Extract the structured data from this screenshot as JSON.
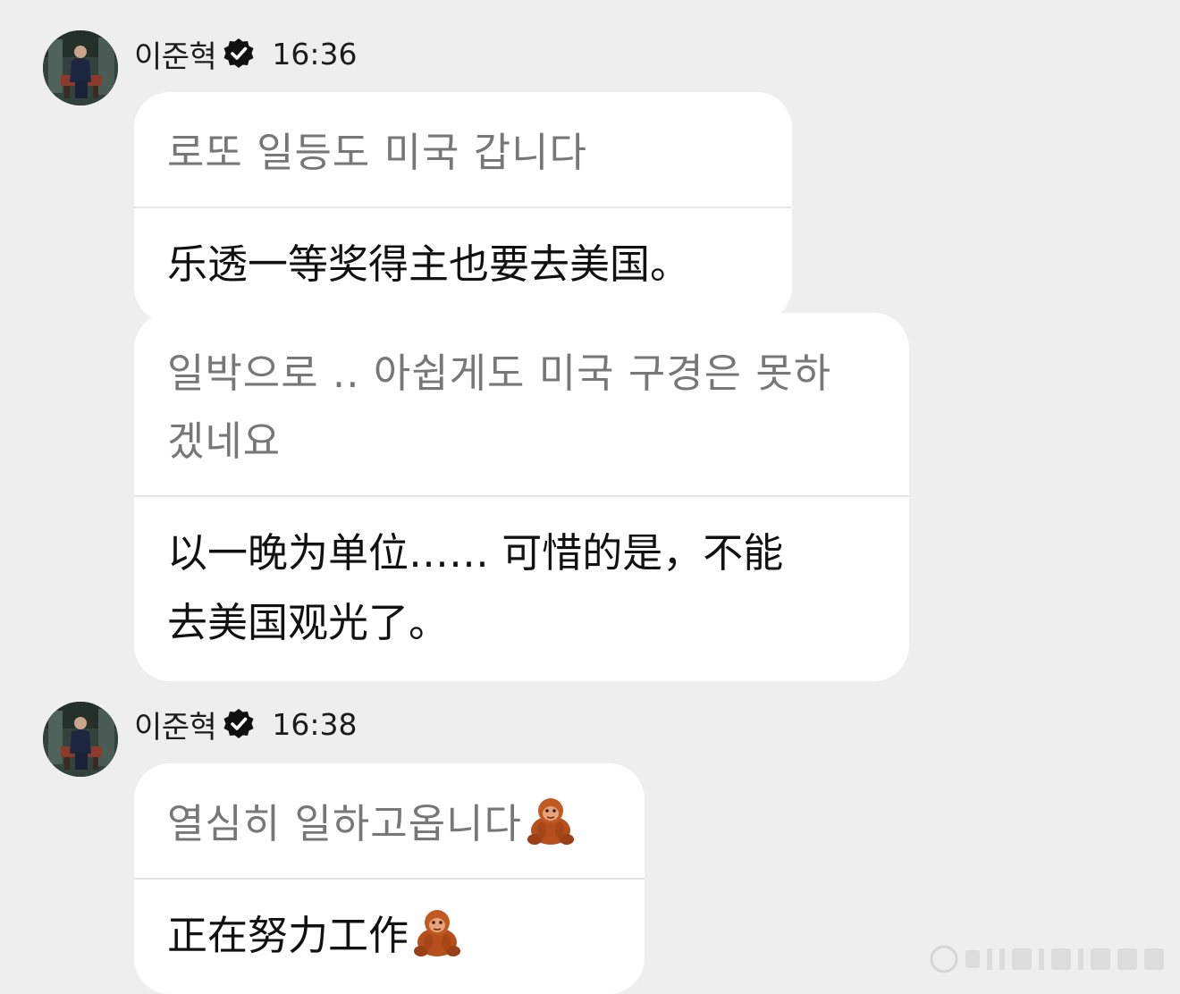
{
  "messages": [
    {
      "sender": "이준혁",
      "time": "16:36",
      "bubbles": [
        {
          "original": "로또 일등도 미국 갑니다",
          "translation": "乐透一等奖得主也要去美国。"
        },
        {
          "original_lines": [
            "일박으로 .. 아쉽게도 미국 구경은 못하",
            "겠네요"
          ],
          "translation_lines": [
            "以一晚为单位…… 可惜的是，不能",
            "去美国观光了。"
          ]
        }
      ]
    },
    {
      "sender": "이준혁",
      "time": "16:38",
      "bubbles": [
        {
          "original": "열심히 일하고옵니다",
          "translation": "正在努力工作",
          "emoji": "orangutan-icon"
        }
      ]
    }
  ],
  "colors": {
    "background": "#eeeeee",
    "bubble": "#ffffff",
    "original_text": "#777777",
    "translation_text": "#111111",
    "divider": "#e6e6e6"
  }
}
